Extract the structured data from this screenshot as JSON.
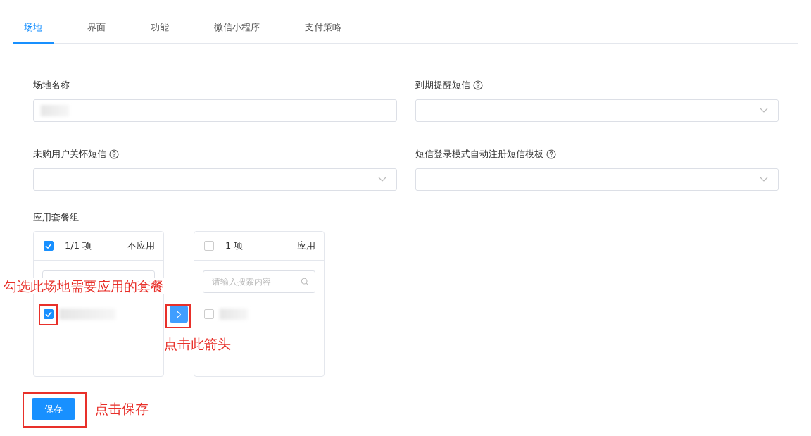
{
  "tabs": [
    {
      "label": "场地",
      "selected": true
    },
    {
      "label": "界面",
      "selected": false
    },
    {
      "label": "功能",
      "selected": false
    },
    {
      "label": "微信小程序",
      "selected": false
    },
    {
      "label": "支付策略",
      "selected": false
    }
  ],
  "fields": [
    {
      "label": "场地名称",
      "kind": "input",
      "help": false,
      "redacted": true
    },
    {
      "label": "到期提醒短信",
      "kind": "select",
      "help": true
    },
    {
      "label": "未购用户关怀短信",
      "kind": "select",
      "help": true
    },
    {
      "label": "短信登录模式自动注册短信模板",
      "kind": "select",
      "help": true
    }
  ],
  "transfer": {
    "label": "应用套餐组",
    "panels": [
      {
        "checked": true,
        "count": "1/1 项",
        "title": "不应用",
        "items": [
          {
            "checked": true,
            "redacted": true
          }
        ]
      },
      {
        "checked": false,
        "count": "1 项",
        "title": "应用",
        "placeholder": "请输入搜索内容",
        "items": [
          {
            "checked": false,
            "redacted": true
          }
        ]
      }
    ]
  },
  "save_button": "保存",
  "annotations": [
    {
      "text": "勾选此场地需要应用的套餐"
    },
    {
      "text": "点击此箭头"
    },
    {
      "text": "点击保存"
    }
  ]
}
